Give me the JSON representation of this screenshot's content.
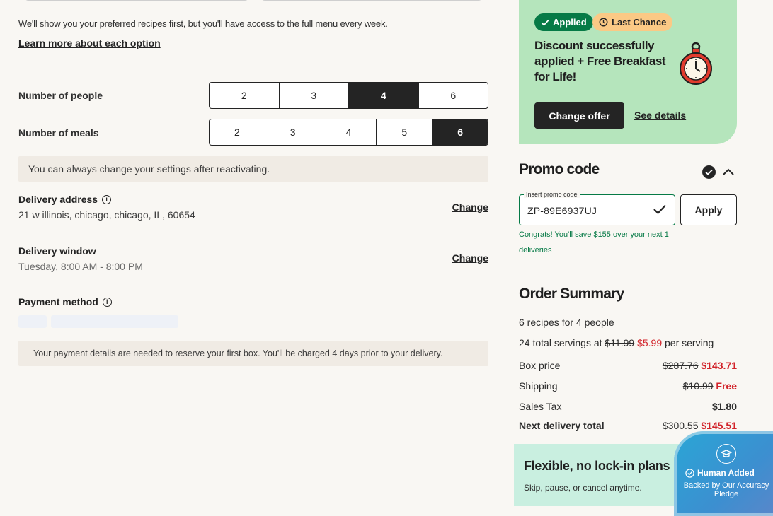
{
  "preferences": {
    "intro_text": "We'll show you your preferred recipes first, but you'll have access to the full menu every week.",
    "learn_more_link": "Learn more about each option",
    "people": {
      "label": "Number of people",
      "options": [
        "2",
        "3",
        "4",
        "6"
      ],
      "selected": "4"
    },
    "meals": {
      "label": "Number of meals",
      "options": [
        "2",
        "3",
        "4",
        "5",
        "6"
      ],
      "selected": "6"
    },
    "settings_notice": "You can always change your settings after reactivating."
  },
  "delivery_address": {
    "title": "Delivery address",
    "value": "21 w illinois, chicago, chicago, IL, 60654",
    "change_link": "Change"
  },
  "delivery_window": {
    "title": "Delivery window",
    "value": "Tuesday, 8:00 AM - 8:00 PM",
    "change_link": "Change"
  },
  "payment": {
    "title": "Payment method",
    "notice": "Your payment details are needed to reserve your first box. You'll be charged 4 days prior to your delivery."
  },
  "offer": {
    "badge_applied": "Applied",
    "badge_last_chance": "Last Chance",
    "title": "Discount successfully applied + Free Breakfast for Life!",
    "change_offer_button": "Change offer",
    "see_details_link": "See details"
  },
  "promo": {
    "title": "Promo code",
    "field_label": "Insert promo code",
    "value": "ZP-89E6937UJ",
    "apply_button": "Apply",
    "success_message": "Congrats! You'll save $155 over your next 1 deliveries"
  },
  "summary": {
    "title": "Order Summary",
    "recipes_line": "6 recipes for 4 people",
    "servings_prefix": "24 total servings at",
    "servings_old": "$11.99",
    "servings_new": "$5.99",
    "servings_suffix": "per serving",
    "rows": [
      {
        "label": "Box price",
        "old": "$287.76",
        "new": "$143.71"
      },
      {
        "label": "Shipping",
        "old": "$10.99",
        "new": "Free"
      },
      {
        "label": "Sales Tax",
        "old": "",
        "new": "$1.80"
      },
      {
        "label": "Next delivery total",
        "old": "$300.55",
        "new": "$145.51"
      }
    ]
  },
  "flexible": {
    "title": "Flexible, no lock-in plans",
    "subtitle": "Skip, pause, or cancel anytime."
  },
  "pledge": {
    "main": "Human Added",
    "sub": "Backed by Our Accuracy Pledge"
  },
  "colors": {
    "green_dark": "#067a46",
    "green_card": "#b5e5bc",
    "sale_red": "#d2232a",
    "dark": "#242424",
    "mint_card": "#c9efe0"
  }
}
